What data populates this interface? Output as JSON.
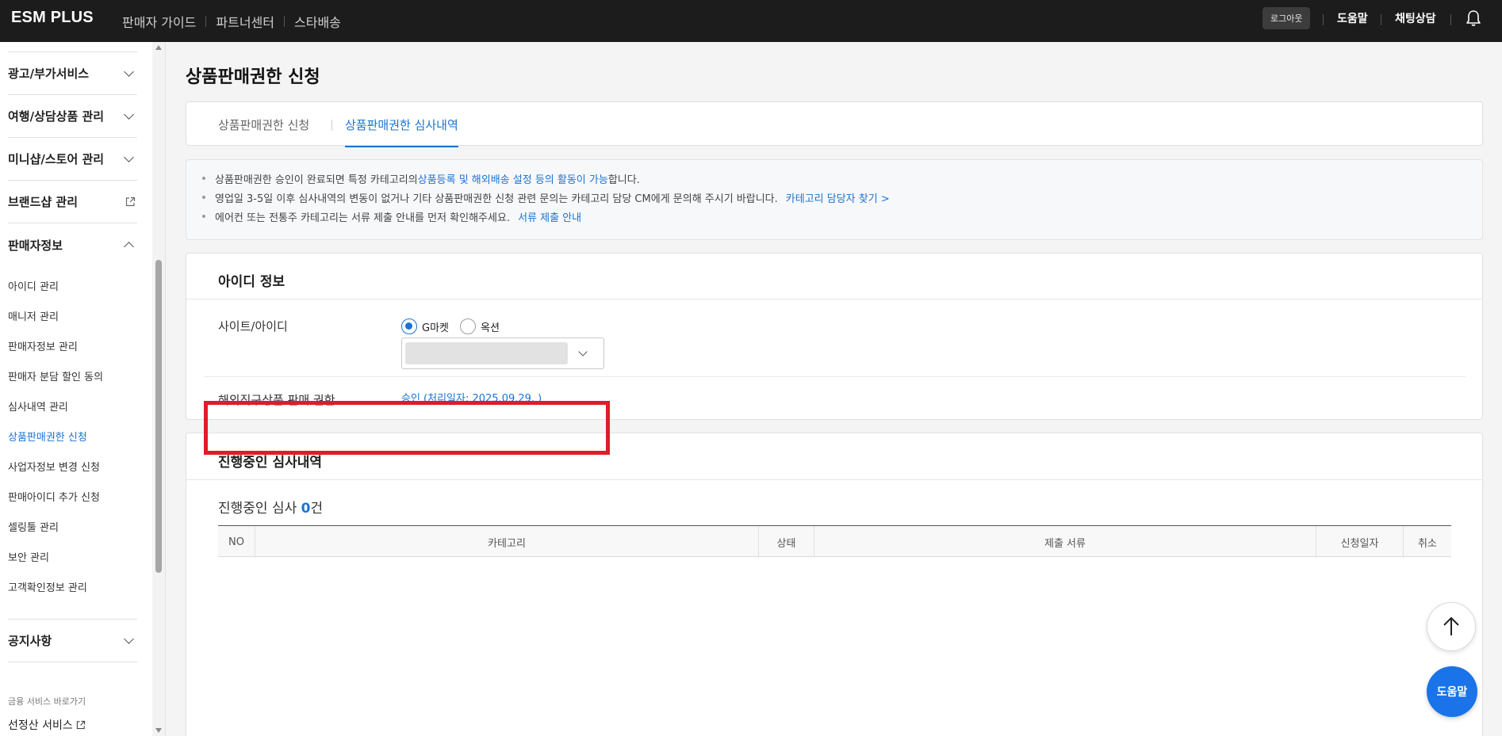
{
  "header": {
    "logo": "ESM PLUS",
    "nav": [
      "판매자 가이드",
      "파트너센터",
      "스타배송"
    ],
    "logout": "로그아웃",
    "help": "도움말",
    "chat": "채팅상담"
  },
  "sidebar": {
    "sections_top": [
      {
        "label": "광고/부가서비스",
        "icon": "chevron-down-icon"
      },
      {
        "label": "여행/상담상품 관리",
        "icon": "chevron-down-icon"
      },
      {
        "label": "미니샵/스토어 관리",
        "icon": "chevron-down-icon"
      },
      {
        "label": "브랜드샵 관리",
        "icon": "external-link-icon"
      },
      {
        "label": "판매자정보",
        "icon": "chevron-up-icon"
      }
    ],
    "items": [
      "아이디 관리",
      "매니저 관리",
      "판매자정보 관리",
      "판매자 분담 할인 동의",
      "심사내역 관리",
      "상품판매권한 신청",
      "사업자정보 변경 신청",
      "판매아이디 추가 신청",
      "셀링툴 관리",
      "보안 관리",
      "고객확인정보 관리"
    ],
    "active_item": "상품판매권한 신청",
    "notice_section": "공지사항",
    "finance_label": "금융 서비스 바로가기",
    "finance_link": "선정산 서비스"
  },
  "main": {
    "title": "상품판매권한 신청",
    "tabs": [
      {
        "label": "상품판매권한 신청",
        "active": false
      },
      {
        "label": "상품판매권한 심사내역",
        "active": true
      }
    ],
    "notice": {
      "line1_a": "상품판매권한 승인이 완료되면 특정 카테고리의 ",
      "line1_link": "상품등록 및 해외배송 설정 등의 활동이 가능",
      "line1_b": "합니다.",
      "line2": "영업일 3-5일 이후 심사내역의 변동이 없거나 기타 상품판매권한 신청 관련 문의는 카테고리 담당 CM에게 문의해 주시기 바랍니다.",
      "line2_link": "카테고리 담당자 찾기 >",
      "line3": "에어컨 또는 전통주 카테고리는 서류 제출 안내를 먼저 확인해주세요.",
      "line3_link": "서류 제출 안내"
    },
    "id_info": {
      "title": "아이디 정보",
      "site_label": "사이트/아이디",
      "radios": [
        {
          "label": "G마켓",
          "checked": true
        },
        {
          "label": "옥션",
          "checked": false
        }
      ],
      "permission_label": "해외직구상품 판매 권한",
      "permission_value": "승인 (처리일자: 2025.09.29. )"
    },
    "review": {
      "title": "진행중인 심사내역",
      "count_prefix": "진행중인 심사 ",
      "count": "0",
      "count_suffix": "건",
      "columns": [
        "NO",
        "카테고리",
        "상태",
        "제출 서류",
        "신청일자",
        "취소"
      ]
    }
  },
  "fab": {
    "help": "도움말"
  },
  "colors": {
    "accent": "#1a73d2",
    "topbar": "#1c1c1c",
    "highlight": "#e21b28"
  }
}
